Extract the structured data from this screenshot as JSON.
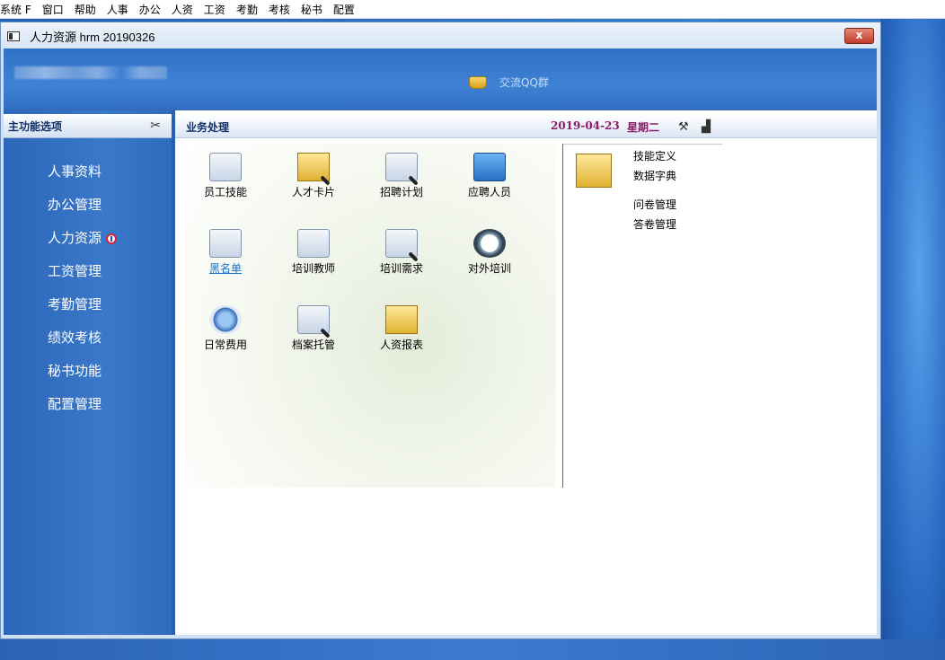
{
  "menubar": {
    "items": [
      "系统 F",
      "窗口",
      "帮助",
      "人事",
      "办公",
      "人资",
      "工资",
      "考勤",
      "考核",
      "秘书",
      "配置"
    ]
  },
  "window": {
    "title": "人力资源 hrm 20190326",
    "close_label": "x"
  },
  "banner": {
    "qq_label": "交流QQ群"
  },
  "sidebar": {
    "title": "主功能选项",
    "items": [
      {
        "label": "人事资料"
      },
      {
        "label": "办公管理"
      },
      {
        "label": "人力资源"
      },
      {
        "label": "工资管理"
      },
      {
        "label": "考勤管理"
      },
      {
        "label": "绩效考核"
      },
      {
        "label": "秘书功能"
      },
      {
        "label": "配置管理"
      }
    ]
  },
  "main": {
    "title": "业务处理",
    "date": "2019-04-23",
    "weekday": "星期二",
    "tiles": [
      {
        "label": "员工技能",
        "icon": "employee-skill-icon"
      },
      {
        "label": "人才卡片",
        "icon": "talent-card-icon"
      },
      {
        "label": "招聘计划",
        "icon": "recruitment-plan-icon"
      },
      {
        "label": "应聘人员",
        "icon": "applicants-icon"
      },
      {
        "label": "黑名单",
        "icon": "blacklist-icon"
      },
      {
        "label": "培训教师",
        "icon": "trainer-icon"
      },
      {
        "label": "培训需求",
        "icon": "training-needs-icon"
      },
      {
        "label": "对外培训",
        "icon": "external-training-icon"
      },
      {
        "label": "日常费用",
        "icon": "daily-expense-icon"
      },
      {
        "label": "档案托管",
        "icon": "archive-hosting-icon"
      },
      {
        "label": "人资报表",
        "icon": "hr-report-icon"
      }
    ],
    "right_links": [
      "技能定义",
      "数据字典",
      "问卷管理",
      "答卷管理"
    ]
  },
  "colors": {
    "sidebar_bg": "#3a78c9",
    "header_text": "#0f2f66",
    "date_text": "#8a1a6c",
    "link": "#1a6fcf"
  }
}
